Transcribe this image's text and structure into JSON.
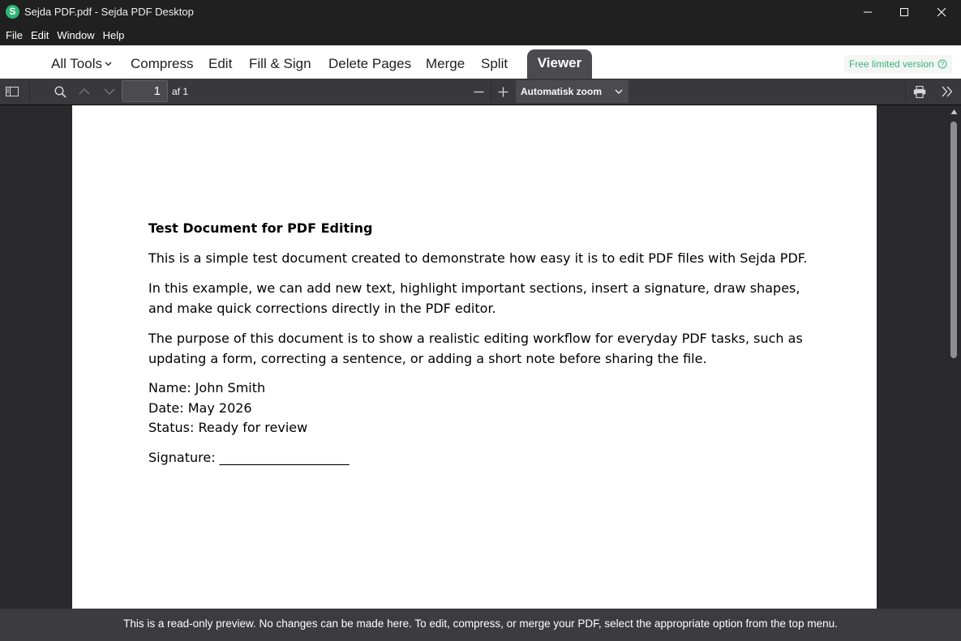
{
  "window": {
    "app_icon_letter": "S",
    "title": "Sejda PDF.pdf - Sejda PDF Desktop"
  },
  "menu": {
    "items": [
      "File",
      "Edit",
      "Window",
      "Help"
    ]
  },
  "tools": {
    "all_tools": "All Tools",
    "compress": "Compress",
    "edit": "Edit",
    "fill_sign": "Fill & Sign",
    "delete_pages": "Delete Pages",
    "merge": "Merge",
    "split": "Split",
    "viewer": "Viewer",
    "free_badge": "Free limited version"
  },
  "viewer_toolbar": {
    "page_number": "1",
    "page_of": "af 1",
    "zoom": "Automatisk zoom"
  },
  "document": {
    "title": "Test Document for PDF Editing",
    "para1": "This is a simple test document created to demonstrate how easy it is to edit PDF files with Sejda PDF.",
    "para2_line1": "In this example, we can add new text, highlight important sections, insert a signature, draw shapes,",
    "para2_line2": "and make quick corrections directly in the PDF editor.",
    "para3_line1": "The purpose of this document is to show a realistic editing workflow for everyday PDF tasks, such as",
    "para3_line2": "updating a form, correcting a sentence, or adding a short note before sharing the file.",
    "name_line": "Name: John Smith",
    "date_line": "Date: May 2026",
    "status_line": "Status: Ready for review",
    "signature_line": "Signature: ____________________"
  },
  "footer": {
    "message": "This is a read-only preview. No changes can be made here. To edit, compress, or merge your PDF, select the appropriate option from the top menu."
  },
  "colors": {
    "brand_green": "#2bb673",
    "viewer_tab_bg": "#4a4a4f",
    "toolbar_bg": "#38383d",
    "footer_bg": "#3c3c40"
  }
}
